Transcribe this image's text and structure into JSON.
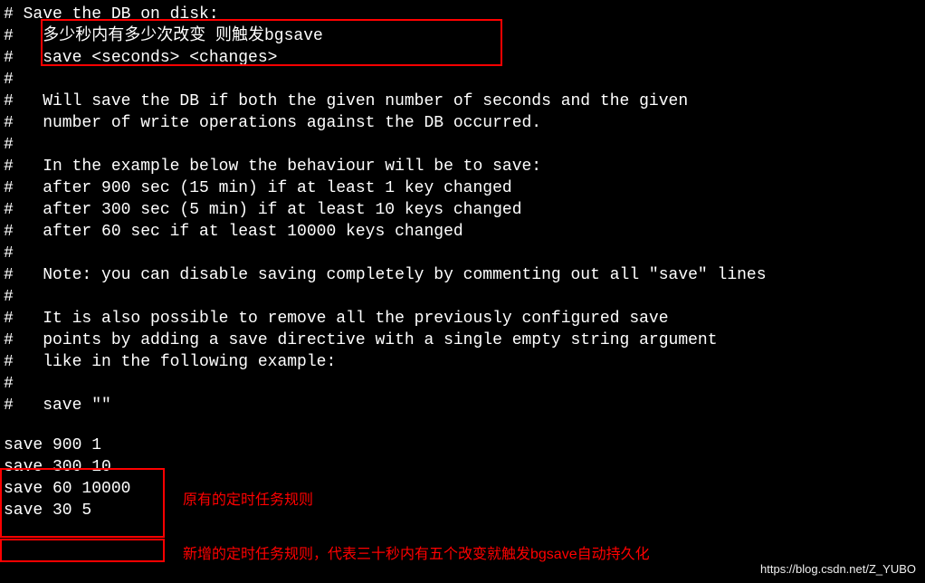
{
  "lines": [
    "# Save the DB on disk:",
    "#   多少秒内有多少次改变 则触发bgsave",
    "#   save <seconds> <changes>",
    "#",
    "#   Will save the DB if both the given number of seconds and the given",
    "#   number of write operations against the DB occurred.",
    "#",
    "#   In the example below the behaviour will be to save:",
    "#   after 900 sec (15 min) if at least 1 key changed",
    "#   after 300 sec (5 min) if at least 10 keys changed",
    "#   after 60 sec if at least 10000 keys changed",
    "#",
    "#   Note: you can disable saving completely by commenting out all \"save\" lines",
    "#",
    "#   It is also possible to remove all the previously configured save",
    "#   points by adding a save directive with a single empty string argument",
    "#   like in the following example:",
    "#",
    "#   save \"\"",
    ""
  ],
  "save_lines": [
    "save 900 1",
    "save 300 10",
    "save 60 10000",
    "save 30 5"
  ],
  "annotations": {
    "note1": "原有的定时任务规则",
    "note2": "新增的定时任务规则，代表三十秒内有五个改变就触发bgsave自动持久化"
  },
  "watermark": "https://blog.csdn.net/Z_YUBO"
}
